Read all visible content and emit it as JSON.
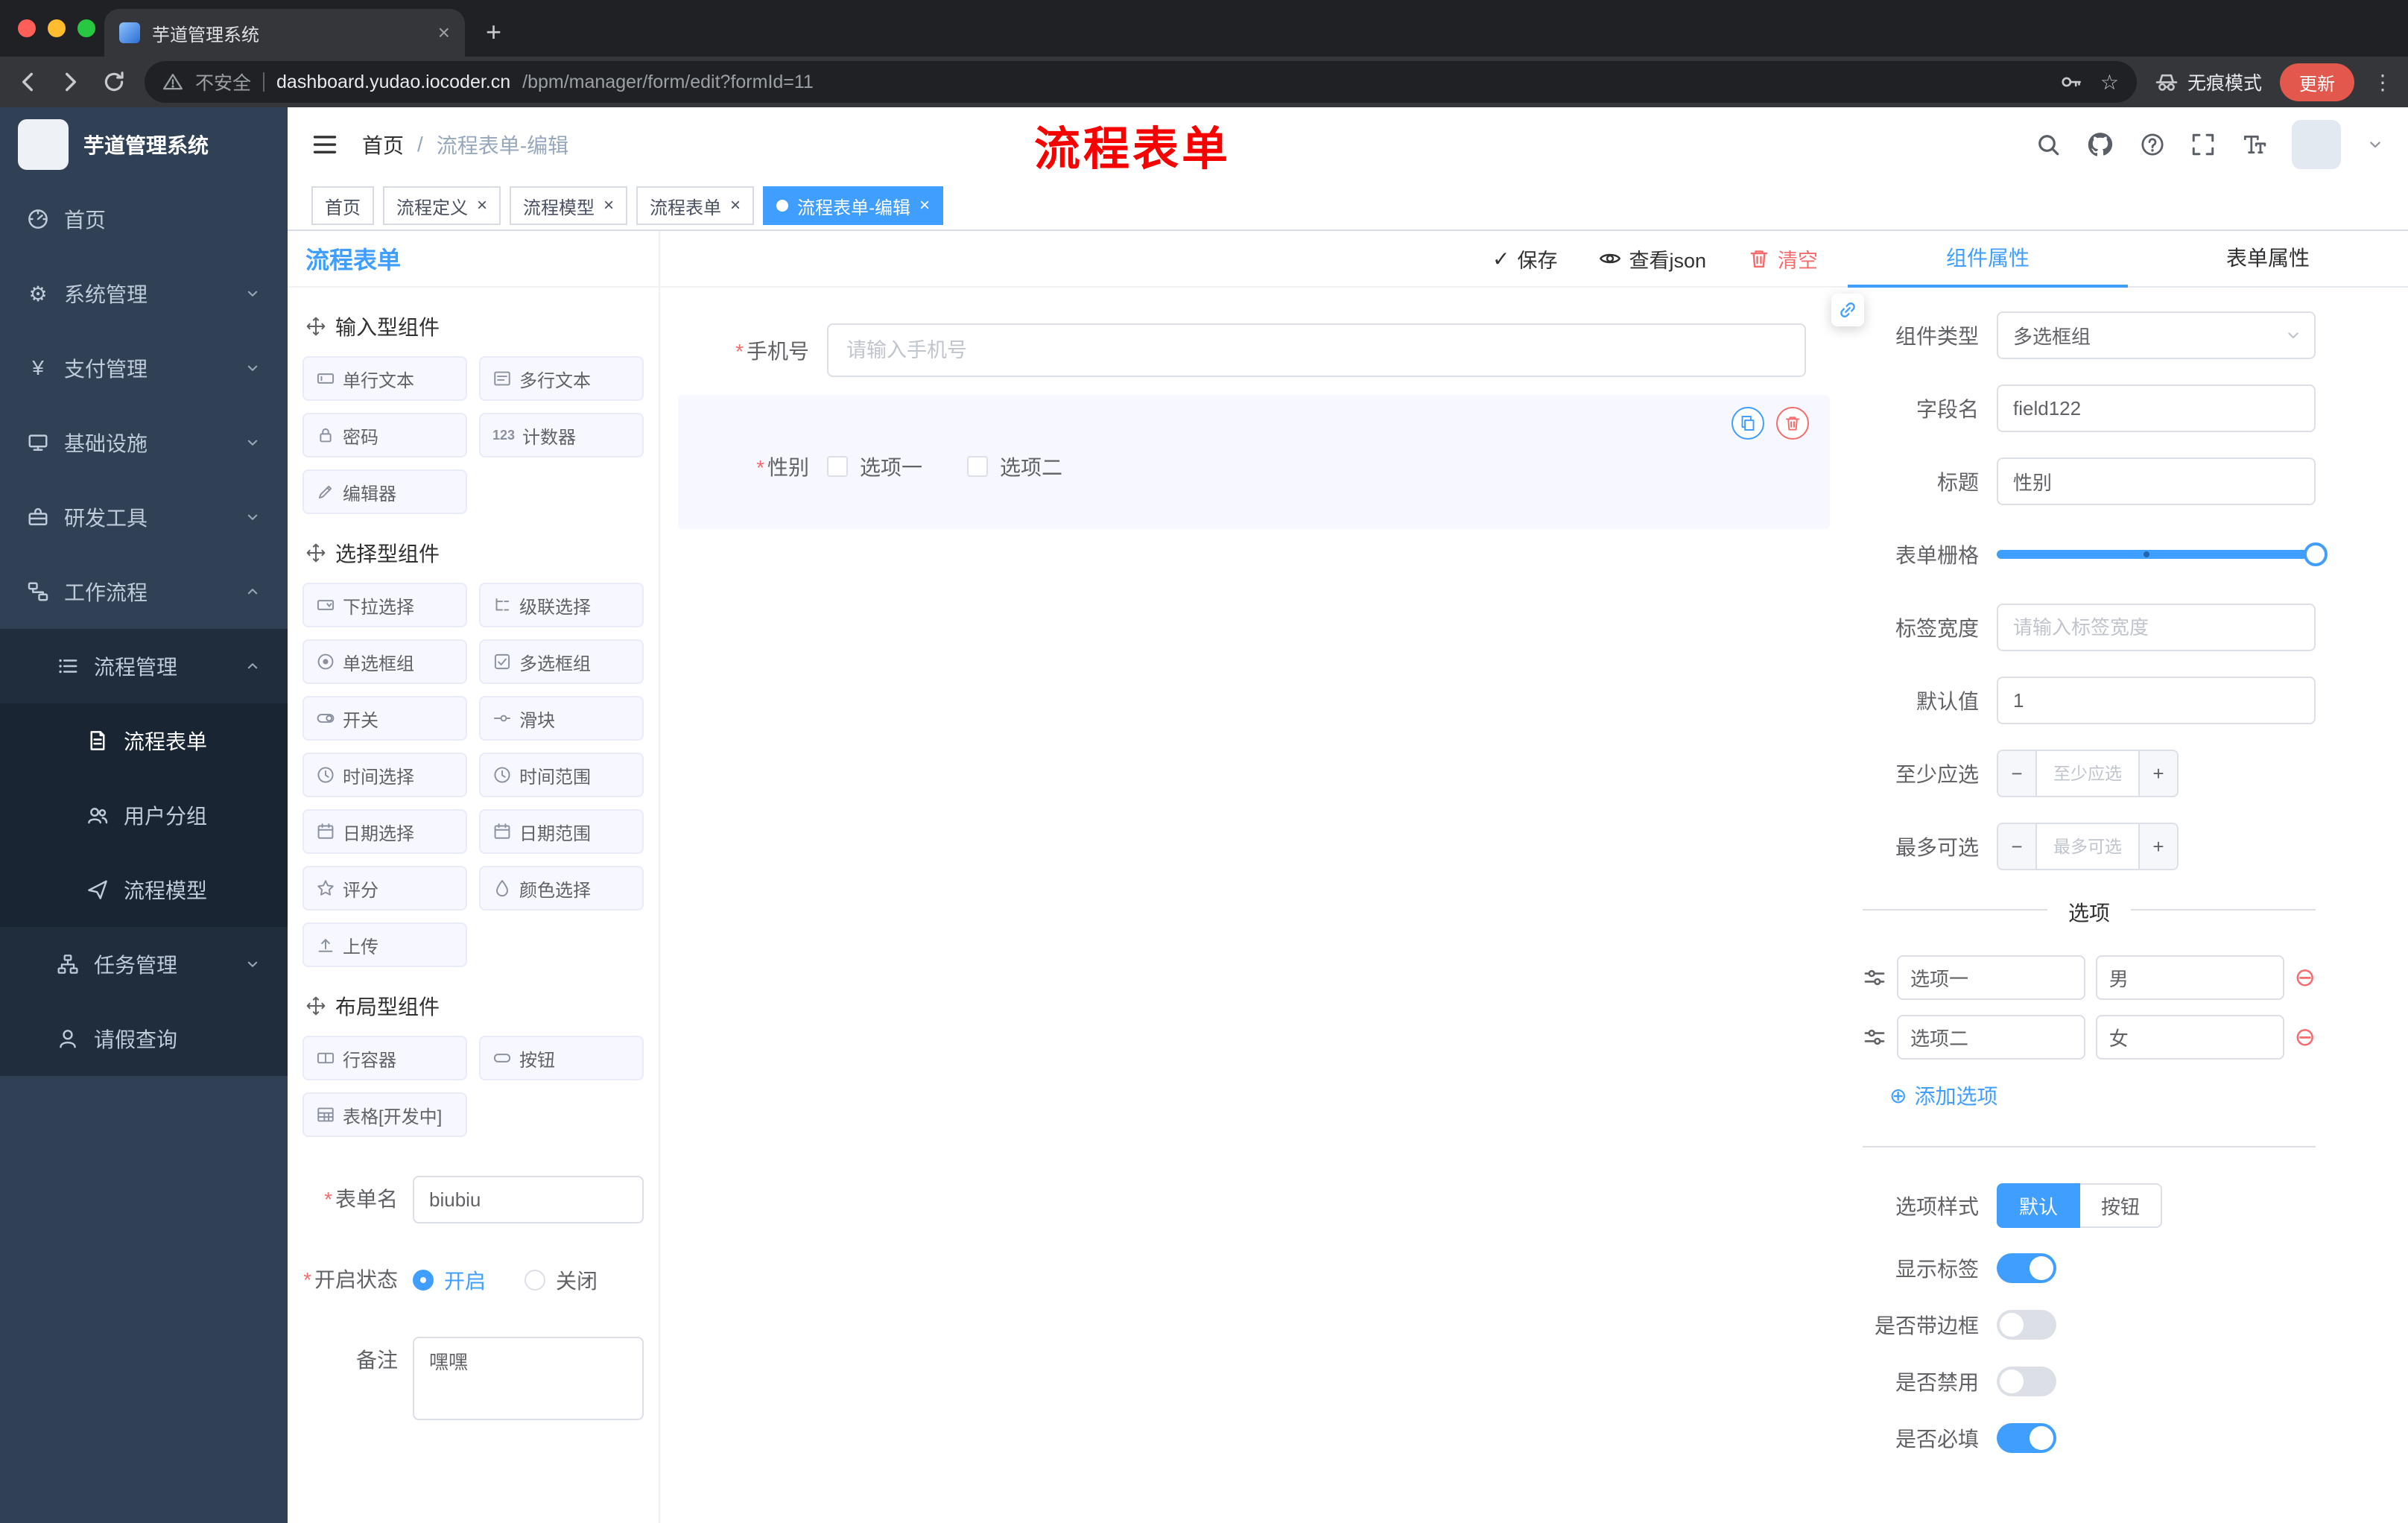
{
  "glyphs": {
    "close": "×",
    "plus": "+",
    "dots_vertical": "⋮",
    "star": "☆",
    "gear": "⚙",
    "yen": "¥",
    "check": "✓",
    "circle_plus": "⊕",
    "circle_minus": "⊖",
    "required": "*",
    "minus": "−",
    "stepper_plus": "+",
    "counter": "123",
    "breadcrumb_sep": "/"
  },
  "browser": {
    "tab_title": "芋道管理系统",
    "security": "不安全",
    "url_domain": "dashboard.yudao.iocoder.cn",
    "url_path": "/bpm/manager/form/edit?formId=11",
    "incognito": "无痕模式",
    "update": "更新"
  },
  "sidebar": {
    "logo_title": "芋道管理系统",
    "items": [
      {
        "label": "首页"
      },
      {
        "label": "系统管理"
      },
      {
        "label": "支付管理"
      },
      {
        "label": "基础设施"
      },
      {
        "label": "研发工具"
      },
      {
        "label": "工作流程"
      },
      {
        "label": "流程管理"
      },
      {
        "label": "流程表单"
      },
      {
        "label": "用户分组"
      },
      {
        "label": "流程模型"
      },
      {
        "label": "任务管理"
      },
      {
        "label": "请假查询"
      }
    ]
  },
  "header": {
    "breadcrumb_home": "首页",
    "breadcrumb_current": "流程表单-编辑",
    "annotation": "流程表单"
  },
  "tags": {
    "items": [
      {
        "label": "首页",
        "closable": false,
        "active": false
      },
      {
        "label": "流程定义",
        "closable": true,
        "active": false
      },
      {
        "label": "流程模型",
        "closable": true,
        "active": false
      },
      {
        "label": "流程表单",
        "closable": true,
        "active": false
      },
      {
        "label": "流程表单-编辑",
        "closable": true,
        "active": true
      }
    ]
  },
  "components_panel": {
    "title": "流程表单",
    "sections": [
      {
        "title": "输入型组件",
        "items": [
          "单行文本",
          "多行文本",
          "密码",
          "计数器",
          "编辑器"
        ]
      },
      {
        "title": "选择型组件",
        "items": [
          "下拉选择",
          "级联选择",
          "单选框组",
          "多选框组",
          "开关",
          "滑块",
          "时间选择",
          "时间范围",
          "日期选择",
          "日期范围",
          "评分",
          "颜色选择",
          "上传"
        ]
      },
      {
        "title": "布局型组件",
        "items": [
          "行容器",
          "按钮",
          "表格[开发中]"
        ]
      }
    ],
    "form": {
      "name_label": "表单名",
      "name_value": "biubiu",
      "status_label": "开启状态",
      "status_on": "开启",
      "status_off": "关闭",
      "remark_label": "备注",
      "remark_value": "嘿嘿"
    }
  },
  "canvas": {
    "toolbar": {
      "save": "保存",
      "view_json": "查看json",
      "clear": "清空"
    },
    "fields": [
      {
        "label": "手机号",
        "placeholder": "请输入手机号"
      },
      {
        "label": "性别",
        "options": [
          "选项一",
          "选项二"
        ]
      }
    ]
  },
  "props_panel": {
    "tab_component": "组件属性",
    "tab_form": "表单属性",
    "component_type_label": "组件类型",
    "component_type_value": "多选框组",
    "field_name_label": "字段名",
    "field_name_value": "field122",
    "title_label": "标题",
    "title_value": "性别",
    "grid_label": "表单栅格",
    "label_width_label": "标签宽度",
    "label_width_placeholder": "请输入标签宽度",
    "default_label": "默认值",
    "default_value": "1",
    "min_label": "至少应选",
    "min_placeholder": "至少应选",
    "max_label": "最多可选",
    "max_placeholder": "最多可选",
    "options_divider": "选项",
    "options": [
      {
        "name": "选项一",
        "value": "男"
      },
      {
        "name": "选项二",
        "value": "女"
      }
    ],
    "add_option": "添加选项",
    "style_label": "选项样式",
    "style_default": "默认",
    "style_button": "按钮",
    "show_label": "显示标签",
    "border_label": "是否带边框",
    "disabled_label": "是否禁用",
    "required_label": "是否必填"
  },
  "colors": {
    "primary": "#409eff",
    "danger": "#f56c6c",
    "sidebar_bg": "#304156",
    "submenu_bg": "#1f2d3d",
    "annotation_red": "#f60000",
    "tag_active": "#409eff"
  }
}
